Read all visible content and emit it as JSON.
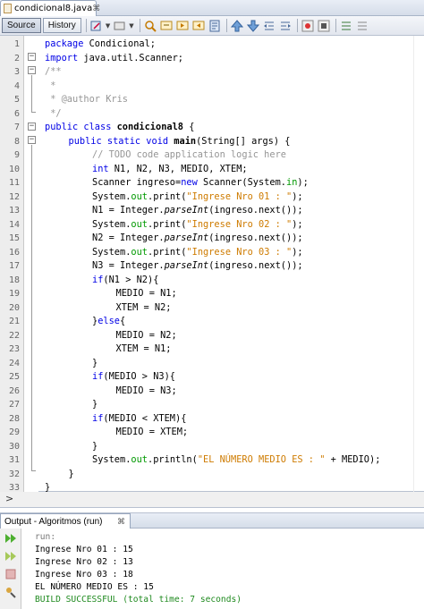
{
  "file_tab": {
    "title": "condicional8.java",
    "close": "⌘"
  },
  "toolbar": {
    "source_label": "Source",
    "history_label": "History"
  },
  "line_numbers": [
    "1",
    "2",
    "3",
    "4",
    "5",
    "6",
    "7",
    "8",
    "9",
    "10",
    "11",
    "12",
    "13",
    "14",
    "15",
    "16",
    "17",
    "18",
    "19",
    "20",
    "21",
    "22",
    "23",
    "24",
    "25",
    "26",
    "27",
    "28",
    "29",
    "30",
    "31",
    "32",
    "33"
  ],
  "code": {
    "l1": {
      "kw": "package",
      "rest": " Condicional;"
    },
    "l2": {
      "kw": "import",
      "rest": " java.util.Scanner;"
    },
    "l3": "/**",
    "l4": " *",
    "l5": " * @author Kris",
    "l6": " */",
    "l7": {
      "kw": "public class",
      "name": " condicional8",
      "rest": " {"
    },
    "l8": {
      "kw": "public static void",
      "name": " main",
      "rest": "(String[] args) {"
    },
    "l9": "// TODO code application logic here",
    "l10": {
      "kw": "int",
      "rest": " N1, N2, N3, MEDIO, XTEM;"
    },
    "l11": {
      "pre": "Scanner ingreso=",
      "kw": "new",
      "mid": " Scanner(System.",
      "fld": "in",
      "post": ");"
    },
    "l12": {
      "pre": "System.",
      "fld": "out",
      "mid": ".print(",
      "str": "\"Ingrese Nro 01 : \"",
      "post": ");"
    },
    "l13": {
      "pre": "N1 = Integer.",
      "it": "parseInt",
      "post": "(ingreso.next());"
    },
    "l14": {
      "pre": "System.",
      "fld": "out",
      "mid": ".print(",
      "str": "\"Ingrese Nro 02 : \"",
      "post": ");"
    },
    "l15": {
      "pre": "N2 = Integer.",
      "it": "parseInt",
      "post": "(ingreso.next());"
    },
    "l16": {
      "pre": "System.",
      "fld": "out",
      "mid": ".print(",
      "str": "\"Ingrese Nro 03 : \"",
      "post": ");"
    },
    "l17": {
      "pre": "N3 = Integer.",
      "it": "parseInt",
      "post": "(ingreso.next());"
    },
    "l18": {
      "kw": "if",
      "rest": "(N1 > N2){"
    },
    "l19": "MEDIO = N1;",
    "l20": "XTEM = N2;",
    "l21": {
      "pre": "}",
      "kw": "else",
      "rest": "{"
    },
    "l22": "MEDIO = N2;",
    "l23": "XTEM = N1;",
    "l24": "}",
    "l25": {
      "kw": "if",
      "rest": "(MEDIO > N3){"
    },
    "l26": "MEDIO = N3;",
    "l27": "}",
    "l28": {
      "kw": "if",
      "rest": "(MEDIO < XTEM){"
    },
    "l29": "MEDIO = XTEM;",
    "l30": "}",
    "l31": {
      "pre": "System.",
      "fld": "out",
      "mid": ".println(",
      "str": "\"EL NÚMERO MEDIO ES : \"",
      "post": " + MEDIO);"
    },
    "l32": "}",
    "l33": "}"
  },
  "expand_marker": ">",
  "output": {
    "tab_title": "Output - Algoritmos (run)",
    "tab_close": "⌘",
    "lines": [
      "run:",
      "Ingrese Nro 01 : 15",
      "Ingrese Nro 02 : 13",
      "Ingrese Nro 03 : 18",
      "EL NÚMERO MEDIO ES : 15",
      "BUILD SUCCESSFUL (total time: 7 seconds)"
    ]
  }
}
